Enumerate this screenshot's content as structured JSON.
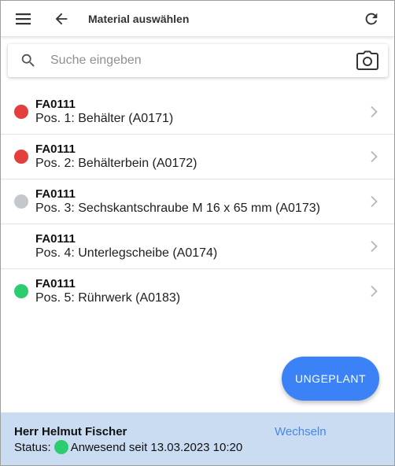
{
  "header": {
    "title": "Material auswählen",
    "menu_icon": "menu-icon",
    "back_icon": "arrow-left-icon",
    "refresh_icon": "refresh-icon"
  },
  "search": {
    "placeholder": "Suche eingeben",
    "value": "",
    "search_icon": "search-icon",
    "camera_icon": "camera-icon"
  },
  "colors": {
    "red": "#e53e3e",
    "gray": "#c4c7cc",
    "green": "#2ecc71",
    "fab": "#3b82f6",
    "footer_bg": "#c9dcf2",
    "link": "#4a86e8"
  },
  "items": [
    {
      "title": "FA0111",
      "subtitle": "Pos. 1: Behälter (A0171)",
      "status_color": "#e53e3e"
    },
    {
      "title": "FA0111",
      "subtitle": "Pos. 2: Behälterbein (A0172)",
      "status_color": "#e53e3e"
    },
    {
      "title": "FA0111",
      "subtitle": "Pos. 3: Sechskantschraube M 16 x 65 mm (A0173)",
      "status_color": "#c4c7cc"
    },
    {
      "title": "FA0111",
      "subtitle": "Pos. 4: Unterlegscheibe (A0174)",
      "status_color": ""
    },
    {
      "title": "FA0111",
      "subtitle": "Pos. 5: Rührwerk (A0183)",
      "status_color": "#2ecc71"
    }
  ],
  "fab": {
    "label": "UNGEPLANT"
  },
  "footer": {
    "user_name": "Herr Helmut Fischer",
    "status_label": "Status:",
    "status_text": "Anwesend seit 13.03.2023 10:20",
    "status_color": "#2ecc71",
    "switch_label": "Wechseln"
  }
}
